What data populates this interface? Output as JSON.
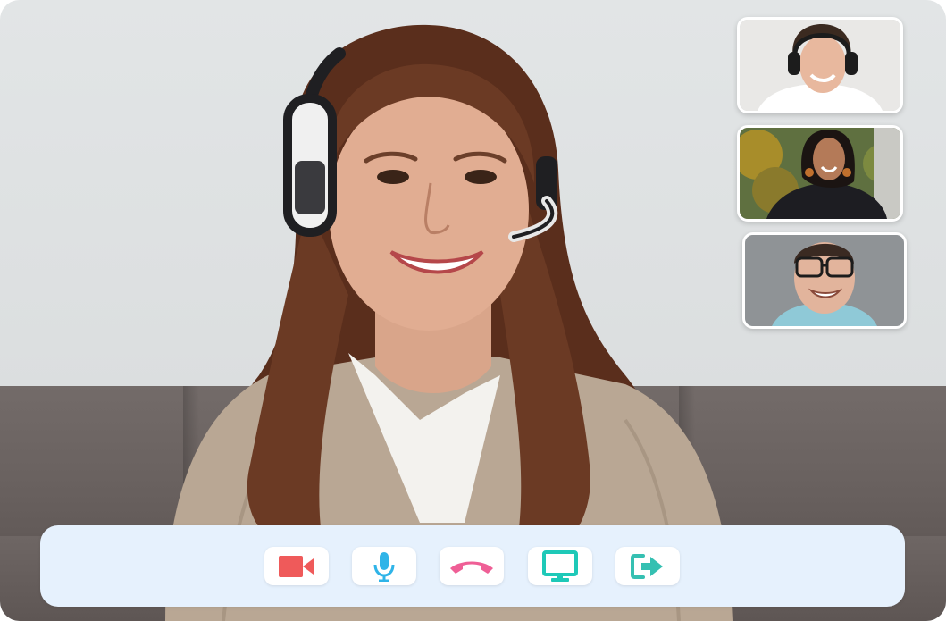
{
  "app": {
    "type": "video-call"
  },
  "main_video": {
    "participant": "main-speaker"
  },
  "thumbnails": [
    {
      "participant": "participant-1"
    },
    {
      "participant": "participant-2"
    },
    {
      "participant": "participant-3"
    }
  ],
  "controls": [
    {
      "name": "camera",
      "icon": "video-camera-icon",
      "color": "#ef5a5a"
    },
    {
      "name": "microphone",
      "icon": "microphone-icon",
      "color": "#2fb4e8"
    },
    {
      "name": "hang-up",
      "icon": "phone-hangup-icon",
      "color": "#ef5f96"
    },
    {
      "name": "share-screen",
      "icon": "monitor-icon",
      "color": "#1ec9b8"
    },
    {
      "name": "leave",
      "icon": "sign-out-icon",
      "color": "#35c0b2"
    }
  ],
  "colors": {
    "control_bar_bg": "#e6f1fd",
    "button_bg": "#ffffff"
  }
}
